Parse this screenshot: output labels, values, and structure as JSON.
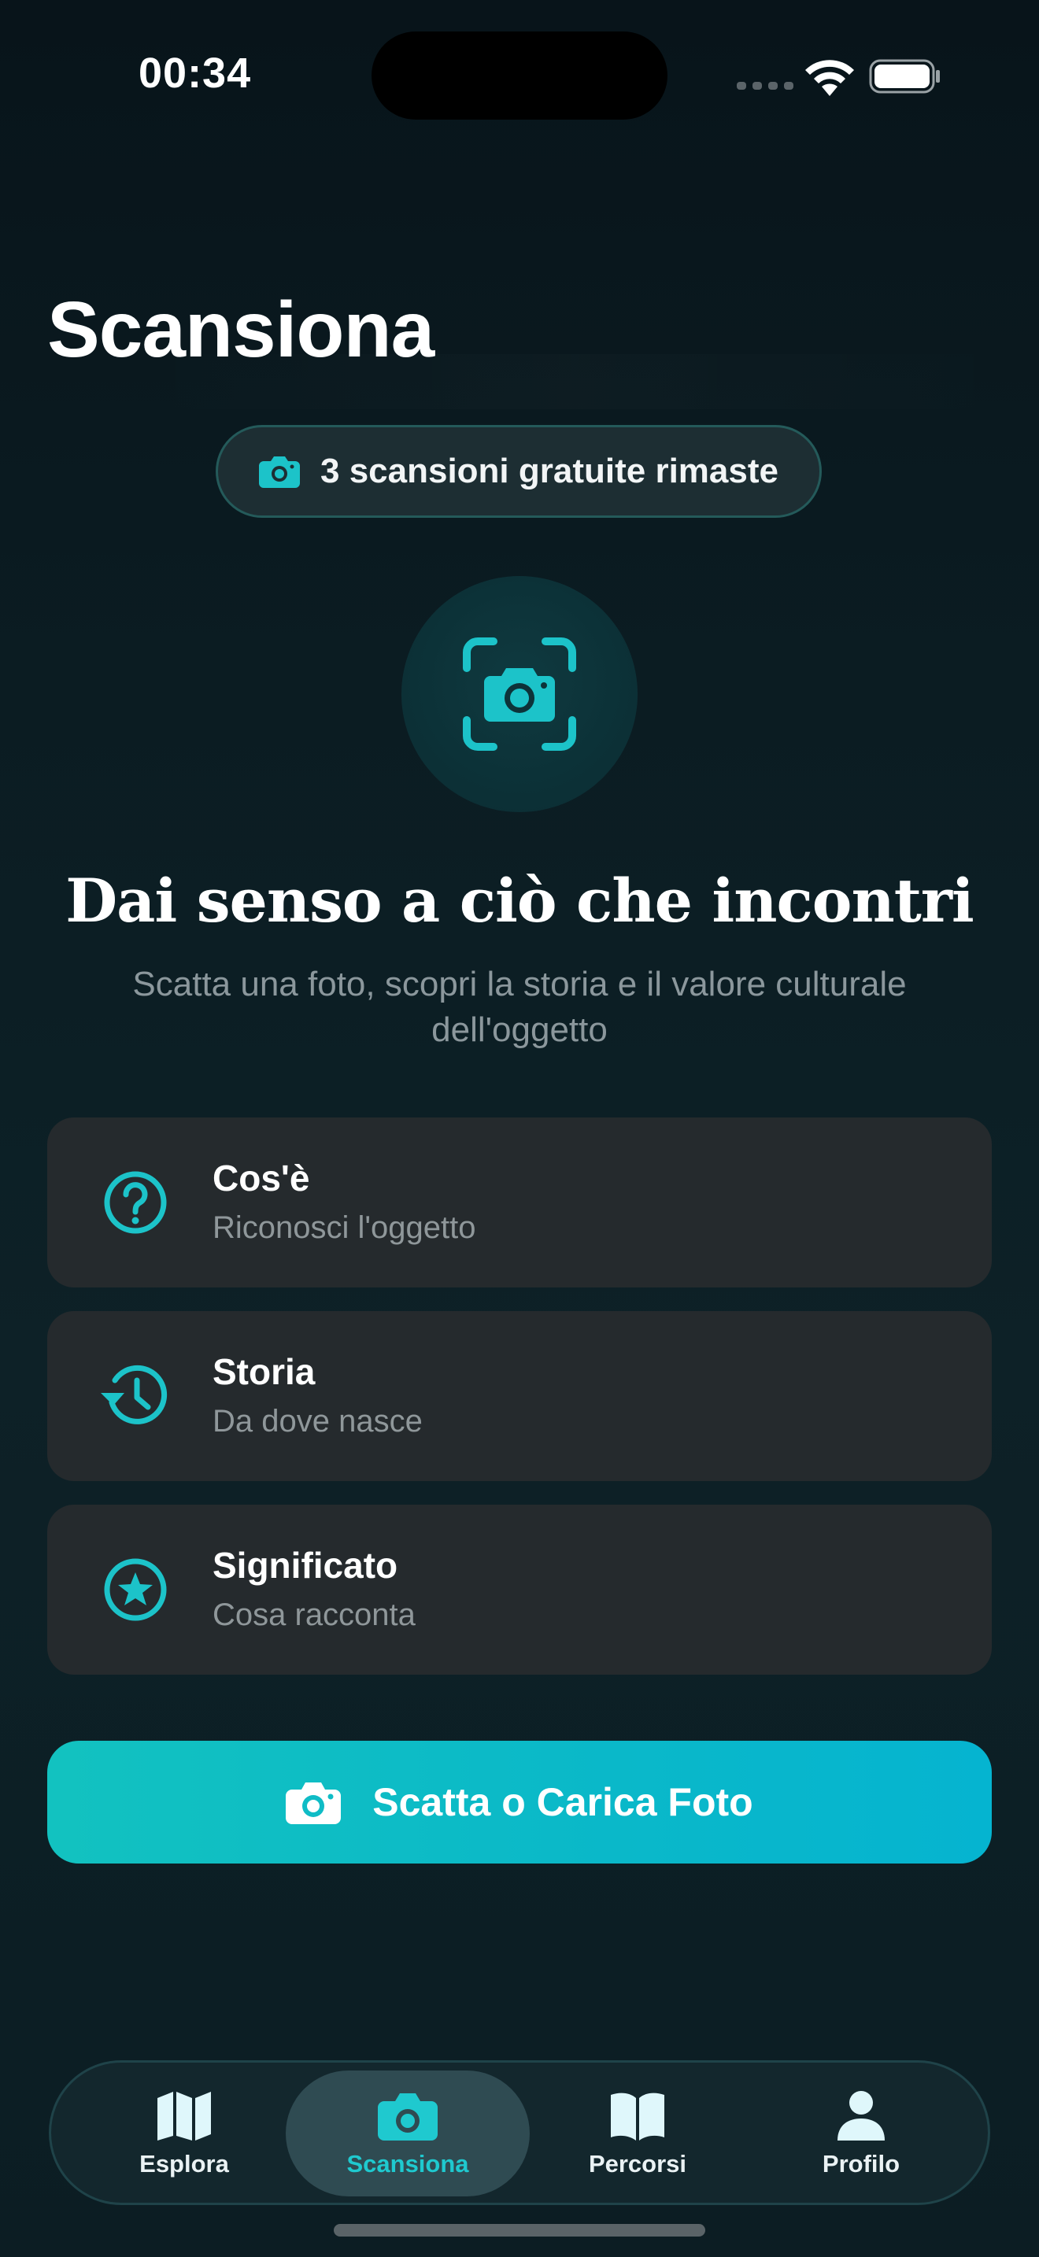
{
  "status_bar": {
    "time": "00:34"
  },
  "header": {
    "title": "Scansiona"
  },
  "free_scans": {
    "icon": "camera-icon",
    "label": "3 scansioni gratuite rimaste"
  },
  "hero": {
    "icon": "camera-viewfinder-icon",
    "headline": "Dai senso a ciò che incontri",
    "subheadline": "Scatta una foto, scopri la storia e il valore culturale dell'oggetto"
  },
  "features": [
    {
      "icon": "question-circle-icon",
      "title": "Cos'è",
      "subtitle": "Riconosci l'oggetto"
    },
    {
      "icon": "history-clock-icon",
      "title": "Storia",
      "subtitle": "Da dove nasce"
    },
    {
      "icon": "star-circle-icon",
      "title": "Significato",
      "subtitle": "Cosa racconta"
    }
  ],
  "cta": {
    "icon": "camera-icon",
    "label": "Scatta o Carica Foto"
  },
  "tabs": [
    {
      "icon": "map-icon",
      "label": "Esplora",
      "active": false
    },
    {
      "icon": "camera-icon",
      "label": "Scansiona",
      "active": true
    },
    {
      "icon": "book-icon",
      "label": "Percorsi",
      "active": false
    },
    {
      "icon": "person-icon",
      "label": "Profilo",
      "active": false
    }
  ],
  "colors": {
    "accent": "#1fc9cf",
    "background": "#0b1c22",
    "card": "#252a2d",
    "cta_start": "#12c2c0",
    "cta_end": "#05b4d0"
  }
}
